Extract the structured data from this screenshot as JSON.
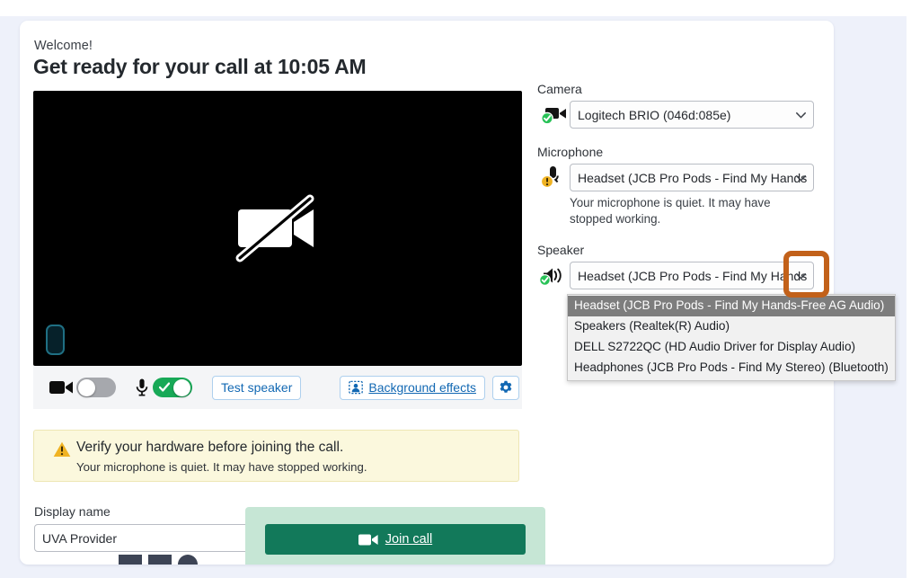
{
  "page": {
    "welcome": "Welcome!",
    "headline": "Get ready for your call at 10:05 AM"
  },
  "video_preview": {
    "camera_state_icon": "camera-off-icon",
    "audio_level_indicator": "mic-level-chip"
  },
  "controls": {
    "camera_toggle": {
      "icon": "video-camera-icon",
      "state": "off"
    },
    "microphone_toggle": {
      "icon": "microphone-icon",
      "state": "on"
    },
    "test_speaker_label": "Test speaker",
    "background_effects_label": "Background effects",
    "background_effects_accesskey": "B",
    "settings_icon": "gear-icon"
  },
  "banner": {
    "icon": "warning-triangle-icon",
    "title": "Verify your hardware before joining the call.",
    "subtitle": "Your microphone is quiet. It may have stopped working."
  },
  "display_name": {
    "label": "Display name",
    "value": "UVA Provider",
    "placeholder": "Display name"
  },
  "join": {
    "label": "Join call",
    "accesskey": "J",
    "icon": "video-camera-icon",
    "button_color": "#12795a",
    "highlight_color": "#c6e6d5"
  },
  "devices": {
    "camera": {
      "label": "Camera",
      "icon": "video-camera-icon",
      "status_badge": "check-badge-green",
      "selected": "Logitech BRIO (046d:085e)"
    },
    "microphone": {
      "label": "Microphone",
      "icon": "microphone-icon",
      "status_badge": "warning-badge-yellow",
      "selected": "Headset (JCB Pro Pods - Find My Hands",
      "note": "Your microphone is quiet. It may have stopped working."
    },
    "speaker": {
      "label": "Speaker",
      "icon": "speaker-waves-icon",
      "status_badge": "check-badge-green",
      "selected": "Headset (JCB Pro Pods - Find My Hands",
      "options": [
        "Headset (JCB Pro Pods - Find My Hands-Free AG Audio)",
        "Speakers (Realtek(R) Audio)",
        "DELL S2722QC (HD Audio Driver for Display Audio)",
        "Headphones (JCB Pro Pods - Find My Stereo) (Bluetooth)"
      ],
      "selected_option_index": 0
    }
  },
  "annotation": {
    "shape": "rounded-rectangle-outline",
    "color": "#c2611a",
    "target": "speaker-select-chevron"
  }
}
